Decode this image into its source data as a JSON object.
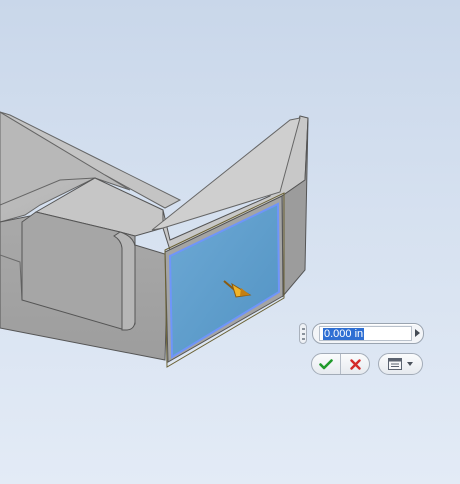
{
  "viewport": {
    "background_top": "#c9d7ea",
    "background_bottom": "#e3ebf6",
    "selected_face_color": "#5b9fd0",
    "selected_face_outline": "#5b8ff0",
    "direction_arrow_color": "#e0a420"
  },
  "mini_toolbar": {
    "grip_icon": "drag-grip-icon",
    "distance_value": "0.000 in",
    "expand_icon": "triangle-right-icon",
    "apply_icon": "green-checkmark-icon",
    "cancel_icon": "red-x-icon",
    "options_icon": "list-options-icon",
    "options_dropdown_icon": "chevron-down-icon"
  }
}
